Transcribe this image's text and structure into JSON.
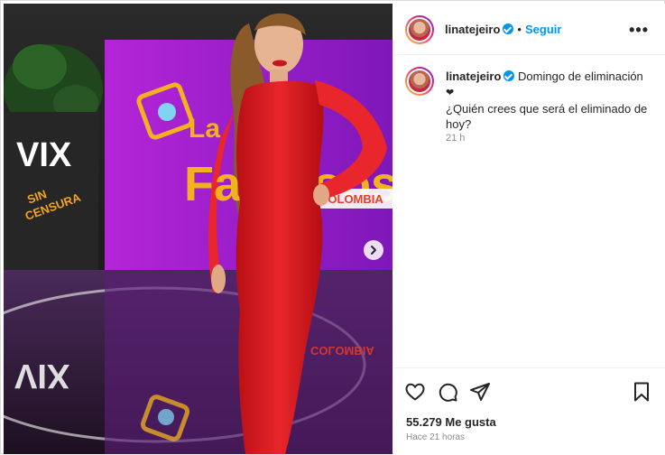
{
  "post": {
    "username": "linatejeiro",
    "follow_label": "Seguir",
    "more_label": "•••",
    "caption_line1": "Domingo de eliminación",
    "caption_heart": "❤",
    "caption_line2": "¿Quién crees que será el eliminado de hoy?",
    "relative_time": "21 h",
    "likes_text": "55.279 Me gusta",
    "posted_text": "Hace 21 horas"
  },
  "media": {
    "logo_vix": "VIX",
    "logo_vix_reflection": "VIX",
    "sin_censura": "SIN\nCENSURA",
    "show_title_la": "La",
    "show_title_main": "Famosos",
    "show_title_country": "COLOMBIA",
    "reflection_country": "COLOMBIA"
  },
  "icons": {
    "like": "heart-icon",
    "comment": "comment-icon",
    "share": "share-icon",
    "save": "bookmark-icon",
    "verified": "verified-badge-icon",
    "next": "chevron-right-icon"
  },
  "colors": {
    "link_blue": "#0095f6",
    "muted_text": "#8e8e8e",
    "dress_red": "#d8141a",
    "screen_purple": "#9b1fd1",
    "title_gold": "#f2b21e"
  }
}
